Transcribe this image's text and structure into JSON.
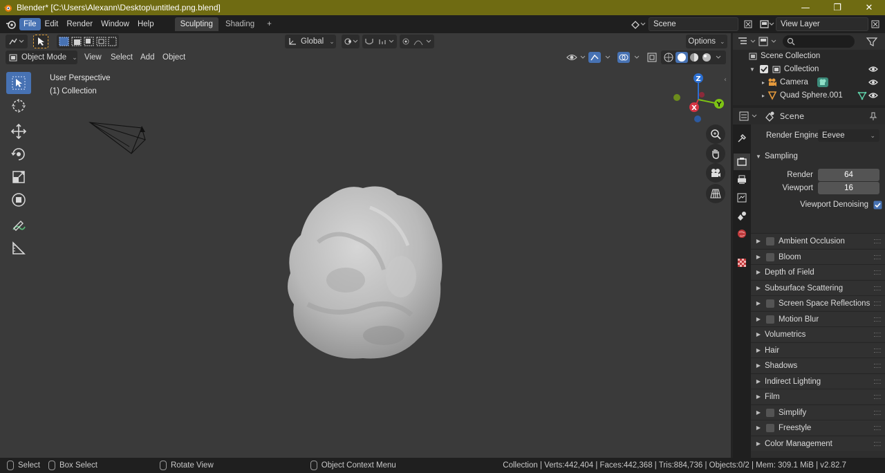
{
  "window": {
    "title": "Blender* [C:\\Users\\Alexann\\Desktop\\untitled.png.blend]",
    "minimize": "—",
    "maximize": "❐",
    "close": "✕"
  },
  "menu": {
    "items": [
      "File",
      "Edit",
      "Render",
      "Window",
      "Help"
    ],
    "active": "File"
  },
  "workspaces": {
    "tabs": [
      "Sculpting",
      "Shading"
    ],
    "active": "Sculpting",
    "add": "+"
  },
  "scene_field": {
    "label": "Scene"
  },
  "view_layer_field": {
    "label": "View Layer"
  },
  "viewport": {
    "header": {
      "transform_orientation": "Global",
      "options_label": "Options"
    },
    "header2": {
      "mode": "Object Mode",
      "items": [
        "View",
        "Select",
        "Add",
        "Object"
      ]
    },
    "overlay": {
      "perspective": "User Perspective",
      "collection": "(1) Collection"
    },
    "gizmo": {
      "z": "Z",
      "x": "X",
      "y": "Y"
    }
  },
  "outliner": {
    "search_placeholder": "",
    "rows": [
      {
        "label": "Scene Collection"
      },
      {
        "label": "Collection"
      },
      {
        "label": "Camera"
      },
      {
        "label": "Quad Sphere.001"
      }
    ]
  },
  "properties": {
    "context": "Scene",
    "render_engine_label": "Render Engine",
    "render_engine_value": "Eevee",
    "sampling": {
      "title": "Sampling",
      "render_label": "Render",
      "render_value": "64",
      "viewport_label": "Viewport",
      "viewport_value": "16",
      "denoise_label": "Viewport Denoising"
    },
    "panels": [
      {
        "label": "Ambient Occlusion",
        "checkbox": true
      },
      {
        "label": "Bloom",
        "checkbox": true
      },
      {
        "label": "Depth of Field",
        "checkbox": false
      },
      {
        "label": "Subsurface Scattering",
        "checkbox": false
      },
      {
        "label": "Screen Space Reflections",
        "checkbox": true
      },
      {
        "label": "Motion Blur",
        "checkbox": true
      },
      {
        "label": "Volumetrics",
        "checkbox": false
      },
      {
        "label": "Hair",
        "checkbox": false
      },
      {
        "label": "Shadows",
        "checkbox": false
      },
      {
        "label": "Indirect Lighting",
        "checkbox": false
      },
      {
        "label": "Film",
        "checkbox": false
      },
      {
        "label": "Simplify",
        "checkbox": true
      },
      {
        "label": "Freestyle",
        "checkbox": true
      },
      {
        "label": "Color Management",
        "checkbox": false
      }
    ]
  },
  "statusbar": {
    "select": "Select",
    "box_select": "Box Select",
    "rotate_view": "Rotate View",
    "context_menu": "Object Context Menu",
    "stats": "Collection | Verts:442,404 | Faces:442,368 | Tris:884,736 | Objects:0/2 | Mem: 309.1 MiB | v2.82.7"
  },
  "colors": {
    "accent": "#4772b3",
    "titlebar": "#6f6b12",
    "viewport_bg": "#3a3a3a"
  }
}
